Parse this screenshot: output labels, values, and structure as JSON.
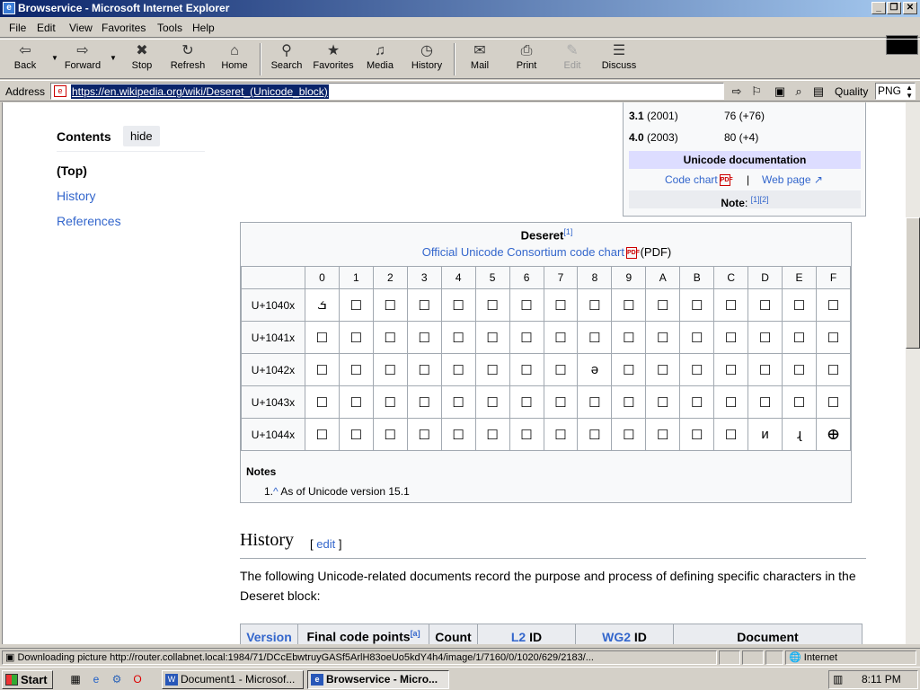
{
  "window": {
    "title": "Browservice - Microsoft Internet Explorer"
  },
  "menu": [
    "File",
    "Edit",
    "View",
    "Favorites",
    "Tools",
    "Help"
  ],
  "toolbar": [
    {
      "label": "Back",
      "icon": "⇦"
    },
    {
      "label": "Forward",
      "icon": "⇨"
    },
    {
      "label": "Stop",
      "icon": "✖"
    },
    {
      "label": "Refresh",
      "icon": "↻"
    },
    {
      "label": "Home",
      "icon": "⌂"
    },
    {
      "label": "Search",
      "icon": "⚲"
    },
    {
      "label": "Favorites",
      "icon": "★"
    },
    {
      "label": "Media",
      "icon": "♫"
    },
    {
      "label": "History",
      "icon": "◷"
    },
    {
      "label": "Mail",
      "icon": "✉"
    },
    {
      "label": "Print",
      "icon": "⎙"
    },
    {
      "label": "Edit",
      "icon": "✎"
    },
    {
      "label": "Discuss",
      "icon": "☰"
    }
  ],
  "address": {
    "label": "Address",
    "url": "https://en.wikipedia.org/wiki/Deseret_(Unicode_block)",
    "quality_label": "Quality",
    "quality_value": "PNG"
  },
  "toc": {
    "title": "Contents",
    "hide": "hide",
    "items": [
      "(Top)",
      "History",
      "References"
    ]
  },
  "infobox": {
    "rows": [
      {
        "ver": "3.1",
        "year": " (2001)",
        "count": "76 (+76)"
      },
      {
        "ver": "4.0",
        "year": " (2003)",
        "count": "80 (+4)"
      }
    ],
    "doc_header": "Unicode documentation",
    "code_chart": "Code chart",
    "sep": "|",
    "web_page": "Web page ↗",
    "note_label": "Note",
    "note_refs": "[1][2]"
  },
  "chart": {
    "title": "Deseret",
    "title_ref": "[1]",
    "link": "Official Unicode Consortium code chart",
    "pdf": "(PDF)",
    "cols": [
      "0",
      "1",
      "2",
      "3",
      "4",
      "5",
      "6",
      "7",
      "8",
      "9",
      "A",
      "B",
      "C",
      "D",
      "E",
      "F"
    ],
    "rows": [
      {
        "label": "U+1040x",
        "cells": [
          "ܭ",
          "☐",
          "☐",
          "☐",
          "☐",
          "☐",
          "☐",
          "☐",
          "☐",
          "☐",
          "☐",
          "☐",
          "☐",
          "☐",
          "☐",
          "☐"
        ]
      },
      {
        "label": "U+1041x",
        "cells": [
          "☐",
          "☐",
          "☐",
          "☐",
          "☐",
          "☐",
          "☐",
          "☐",
          "☐",
          "☐",
          "☐",
          "☐",
          "☐",
          "☐",
          "☐",
          "☐"
        ]
      },
      {
        "label": "U+1042x",
        "cells": [
          "☐",
          "☐",
          "☐",
          "☐",
          "☐",
          "☐",
          "☐",
          "☐",
          "ə",
          "☐",
          "☐",
          "☐",
          "☐",
          "☐",
          "☐",
          "☐"
        ]
      },
      {
        "label": "U+1043x",
        "cells": [
          "☐",
          "☐",
          "☐",
          "☐",
          "☐",
          "☐",
          "☐",
          "☐",
          "☐",
          "☐",
          "☐",
          "☐",
          "☐",
          "☐",
          "☐",
          "☐"
        ]
      },
      {
        "label": "U+1044x",
        "cells": [
          "☐",
          "☐",
          "☐",
          "☐",
          "☐",
          "☐",
          "☐",
          "☐",
          "☐",
          "☐",
          "☐",
          "☐",
          "☐",
          "ᴎ",
          "ɻ",
          "ⴲ"
        ]
      }
    ],
    "notes_title": "Notes",
    "note1_num": "1.",
    "note1_caret": "^",
    "note1_text": " As of Unicode version 15.1"
  },
  "history": {
    "heading": "History",
    "edit": "edit",
    "para": "The following Unicode-related documents record the purpose and process of defining specific characters in the Deseret block:",
    "columns": [
      {
        "t": "Version",
        "link": true
      },
      {
        "t": "Final code points",
        "sup": "[a]"
      },
      {
        "t": "Count"
      },
      {
        "t": "L2",
        "link": true,
        "suffix": " ID"
      },
      {
        "t": "WG2",
        "link": true,
        "suffix": " ID"
      },
      {
        "t": "Document"
      }
    ]
  },
  "status": {
    "text": "Downloading picture http://router.collabnet.local:1984/71/DCcEbwtruyGASf5ArlH83oeUo5kdY4h4/image/1/7160/0/1020/629/2183/...",
    "zone": "Internet"
  },
  "taskbar": {
    "start": "Start",
    "tasks": [
      "Document1 - Microsof...",
      "Browservice - Micro..."
    ],
    "time": "8:11 PM"
  }
}
